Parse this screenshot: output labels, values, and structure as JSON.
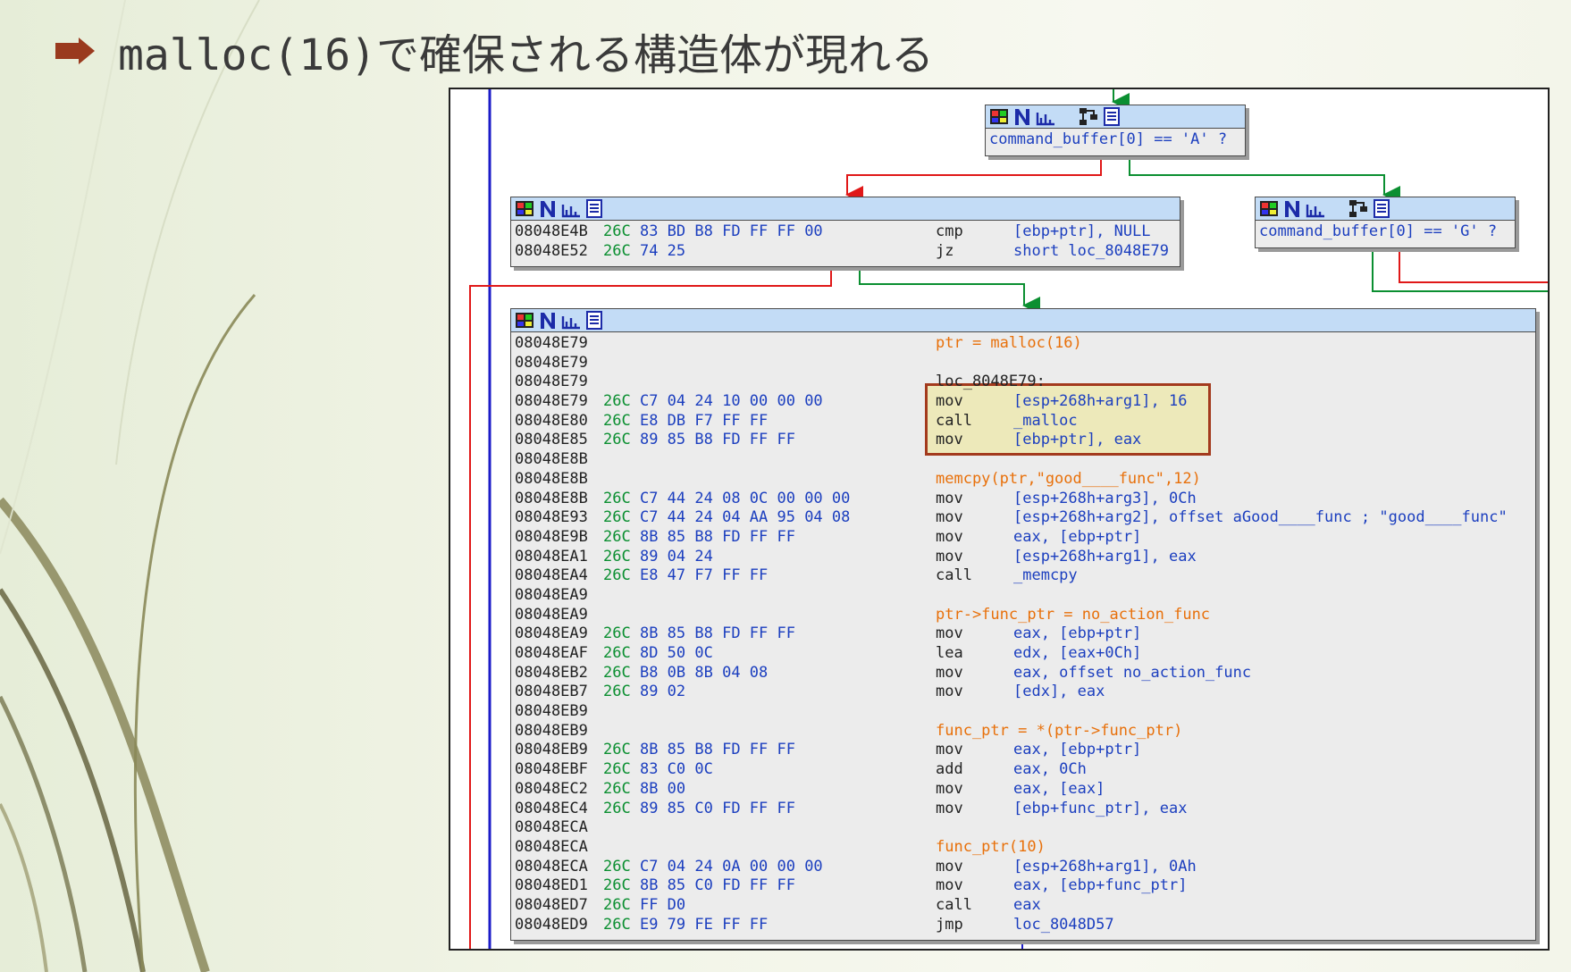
{
  "slide": {
    "title": "malloc(16)で確保される構造体が現れる"
  },
  "colors": {
    "bullet": "#9a3a1e",
    "address_text": "#222222",
    "bytes_text": "#1c3fbf",
    "comment_text": "#e8700a",
    "node_header": "#c3dcf6",
    "node_body": "#ececec",
    "highlight_border": "#a33a1d",
    "highlight_fill": "#eee8aa",
    "edge_true": "#0b8f31",
    "edge_false": "#e01818",
    "edge_jump": "#1c1cc8"
  },
  "nodes": {
    "top": {
      "condition": "command_buffer[0] == 'A' ?"
    },
    "right": {
      "condition": "command_buffer[0] == 'G' ?"
    },
    "cmp": {
      "lines": [
        {
          "addr": "08048E4B",
          "sp": "26C",
          "bytes": "83 BD B8 FD FF FF 00",
          "mn": "cmp",
          "ops": "[ebp+ptr], NULL"
        },
        {
          "addr": "08048E52",
          "sp": "26C",
          "bytes": "74 25",
          "mn": "jz",
          "ops": "short loc_8048E79"
        }
      ]
    },
    "main": {
      "lines": [
        {
          "addr": "08048E79",
          "sp": "",
          "bytes": "",
          "mn": "",
          "ops": "",
          "comment": "ptr = malloc(16)"
        },
        {
          "addr": "08048E79",
          "sp": "",
          "bytes": "",
          "mn": "",
          "ops": "",
          "comment": ""
        },
        {
          "addr": "08048E79",
          "sp": "",
          "bytes": "",
          "mn": "",
          "ops": "",
          "label": "loc_8048E79:"
        },
        {
          "addr": "08048E79",
          "sp": "26C",
          "bytes": "C7 04 24 10 00 00 00",
          "mn": "mov",
          "ops": "[esp+268h+arg1], 16"
        },
        {
          "addr": "08048E80",
          "sp": "26C",
          "bytes": "E8 DB F7 FF FF",
          "mn": "call",
          "ops": "_malloc"
        },
        {
          "addr": "08048E85",
          "sp": "26C",
          "bytes": "89 85 B8 FD FF FF",
          "mn": "mov",
          "ops": "[ebp+ptr], eax"
        },
        {
          "addr": "08048E8B",
          "sp": "",
          "bytes": "",
          "mn": "",
          "ops": "",
          "comment": ""
        },
        {
          "addr": "08048E8B",
          "sp": "",
          "bytes": "",
          "mn": "",
          "ops": "",
          "comment": "memcpy(ptr,\"good____func\",12)"
        },
        {
          "addr": "08048E8B",
          "sp": "26C",
          "bytes": "C7 44 24 08 0C 00 00 00",
          "mn": "mov",
          "ops": "[esp+268h+arg3], 0Ch"
        },
        {
          "addr": "08048E93",
          "sp": "26C",
          "bytes": "C7 44 24 04 AA 95 04 08",
          "mn": "mov",
          "ops": "[esp+268h+arg2], offset aGood____func ; \"good____func\""
        },
        {
          "addr": "08048E9B",
          "sp": "26C",
          "bytes": "8B 85 B8 FD FF FF",
          "mn": "mov",
          "ops": "eax, [ebp+ptr]"
        },
        {
          "addr": "08048EA1",
          "sp": "26C",
          "bytes": "89 04 24",
          "mn": "mov",
          "ops": "[esp+268h+arg1], eax"
        },
        {
          "addr": "08048EA4",
          "sp": "26C",
          "bytes": "E8 47 F7 FF FF",
          "mn": "call",
          "ops": "_memcpy"
        },
        {
          "addr": "08048EA9",
          "sp": "",
          "bytes": "",
          "mn": "",
          "ops": "",
          "comment": ""
        },
        {
          "addr": "08048EA9",
          "sp": "",
          "bytes": "",
          "mn": "",
          "ops": "",
          "comment": "ptr->func_ptr = no_action_func"
        },
        {
          "addr": "08048EA9",
          "sp": "26C",
          "bytes": "8B 85 B8 FD FF FF",
          "mn": "mov",
          "ops": "eax, [ebp+ptr]"
        },
        {
          "addr": "08048EAF",
          "sp": "26C",
          "bytes": "8D 50 0C",
          "mn": "lea",
          "ops": "edx, [eax+0Ch]"
        },
        {
          "addr": "08048EB2",
          "sp": "26C",
          "bytes": "B8 0B 8B 04 08",
          "mn": "mov",
          "ops": "eax, offset no_action_func"
        },
        {
          "addr": "08048EB7",
          "sp": "26C",
          "bytes": "89 02",
          "mn": "mov",
          "ops": "[edx], eax"
        },
        {
          "addr": "08048EB9",
          "sp": "",
          "bytes": "",
          "mn": "",
          "ops": "",
          "comment": ""
        },
        {
          "addr": "08048EB9",
          "sp": "",
          "bytes": "",
          "mn": "",
          "ops": "",
          "comment": "func_ptr = *(ptr->func_ptr)"
        },
        {
          "addr": "08048EB9",
          "sp": "26C",
          "bytes": "8B 85 B8 FD FF FF",
          "mn": "mov",
          "ops": "eax, [ebp+ptr]"
        },
        {
          "addr": "08048EBF",
          "sp": "26C",
          "bytes": "83 C0 0C",
          "mn": "add",
          "ops": "eax, 0Ch"
        },
        {
          "addr": "08048EC2",
          "sp": "26C",
          "bytes": "8B 00",
          "mn": "mov",
          "ops": "eax, [eax]"
        },
        {
          "addr": "08048EC4",
          "sp": "26C",
          "bytes": "89 85 C0 FD FF FF",
          "mn": "mov",
          "ops": "[ebp+func_ptr], eax"
        },
        {
          "addr": "08048ECA",
          "sp": "",
          "bytes": "",
          "mn": "",
          "ops": "",
          "comment": ""
        },
        {
          "addr": "08048ECA",
          "sp": "",
          "bytes": "",
          "mn": "",
          "ops": "",
          "comment": "func_ptr(10)"
        },
        {
          "addr": "08048ECA",
          "sp": "26C",
          "bytes": "C7 04 24 0A 00 00 00",
          "mn": "mov",
          "ops": "[esp+268h+arg1], 0Ah"
        },
        {
          "addr": "08048ED1",
          "sp": "26C",
          "bytes": "8B 85 C0 FD FF FF",
          "mn": "mov",
          "ops": "eax, [ebp+func_ptr]"
        },
        {
          "addr": "08048ED7",
          "sp": "26C",
          "bytes": "FF D0",
          "mn": "call",
          "ops": "eax"
        },
        {
          "addr": "08048ED9",
          "sp": "26C",
          "bytes": "E9 79 FE FF FF",
          "mn": "jmp",
          "ops": "loc_8048D57"
        }
      ]
    }
  },
  "node_icons": [
    "palette-icon",
    "n-icon",
    "graph-icon",
    "flowchart-icon",
    "list-icon"
  ]
}
